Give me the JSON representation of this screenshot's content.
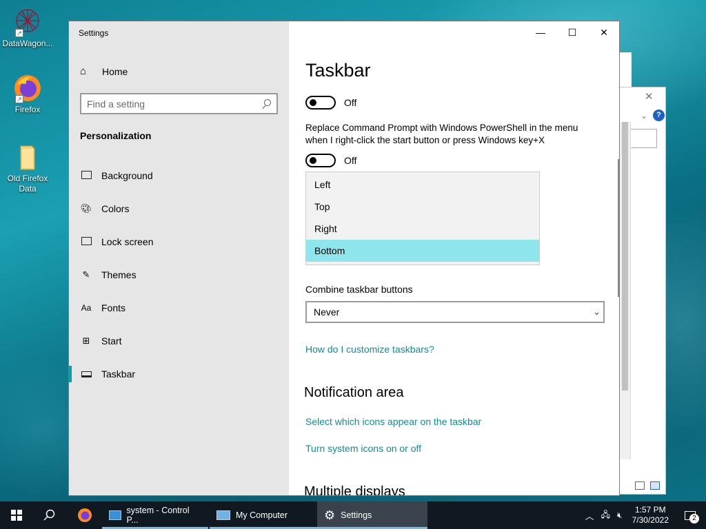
{
  "desktop": {
    "icons": [
      {
        "label": "DataWagon...",
        "icon": "datawagon-icon"
      },
      {
        "label": "Firefox",
        "icon": "firefox-icon"
      },
      {
        "label": "Old Firefox Data",
        "icon": "folder-icon"
      }
    ]
  },
  "settings": {
    "window_title": "Settings",
    "controls": {
      "minimize": "—",
      "maximize": "☐",
      "close": "✕"
    },
    "sidebar": {
      "home_label": "Home",
      "search_placeholder": "Find a setting",
      "section": "Personalization",
      "items": [
        {
          "label": "Background",
          "icon": "background-icon"
        },
        {
          "label": "Colors",
          "icon": "palette-icon"
        },
        {
          "label": "Lock screen",
          "icon": "lock-screen-icon"
        },
        {
          "label": "Themes",
          "icon": "themes-icon"
        },
        {
          "label": "Fonts",
          "icon": "fonts-icon"
        },
        {
          "label": "Start",
          "icon": "start-icon"
        },
        {
          "label": "Taskbar",
          "icon": "taskbar-icon",
          "active": true
        }
      ]
    },
    "content": {
      "title": "Taskbar",
      "toggle1_state": "Off",
      "powershell_desc": "Replace Command Prompt with Windows PowerShell in the menu when I right-click the start button or press Windows key+X",
      "toggle2_state": "Off",
      "location_options": [
        "Left",
        "Top",
        "Right",
        "Bottom"
      ],
      "location_selected": "Bottom",
      "combine_label": "Combine taskbar buttons",
      "combine_value": "Never",
      "customize_link": "How do I customize taskbars?",
      "notification_title": "Notification area",
      "notif_link1": "Select which icons appear on the taskbar",
      "notif_link2": "Turn system icons on or off",
      "multiple_displays_title": "Multiple displays"
    }
  },
  "taskbar": {
    "apps": [
      {
        "label": "system - Control P...",
        "icon": "control-panel-icon"
      },
      {
        "label": "My Computer",
        "icon": "computer-icon"
      },
      {
        "label": "Settings",
        "icon": "settings-gear-icon",
        "active": true
      }
    ],
    "time": "1:57 PM",
    "date": "7/30/2022",
    "notification_count": "2"
  },
  "colors": {
    "accent": "#0f9aa8",
    "selected_option": "#8ee6ec",
    "link": "#0f8c99"
  }
}
